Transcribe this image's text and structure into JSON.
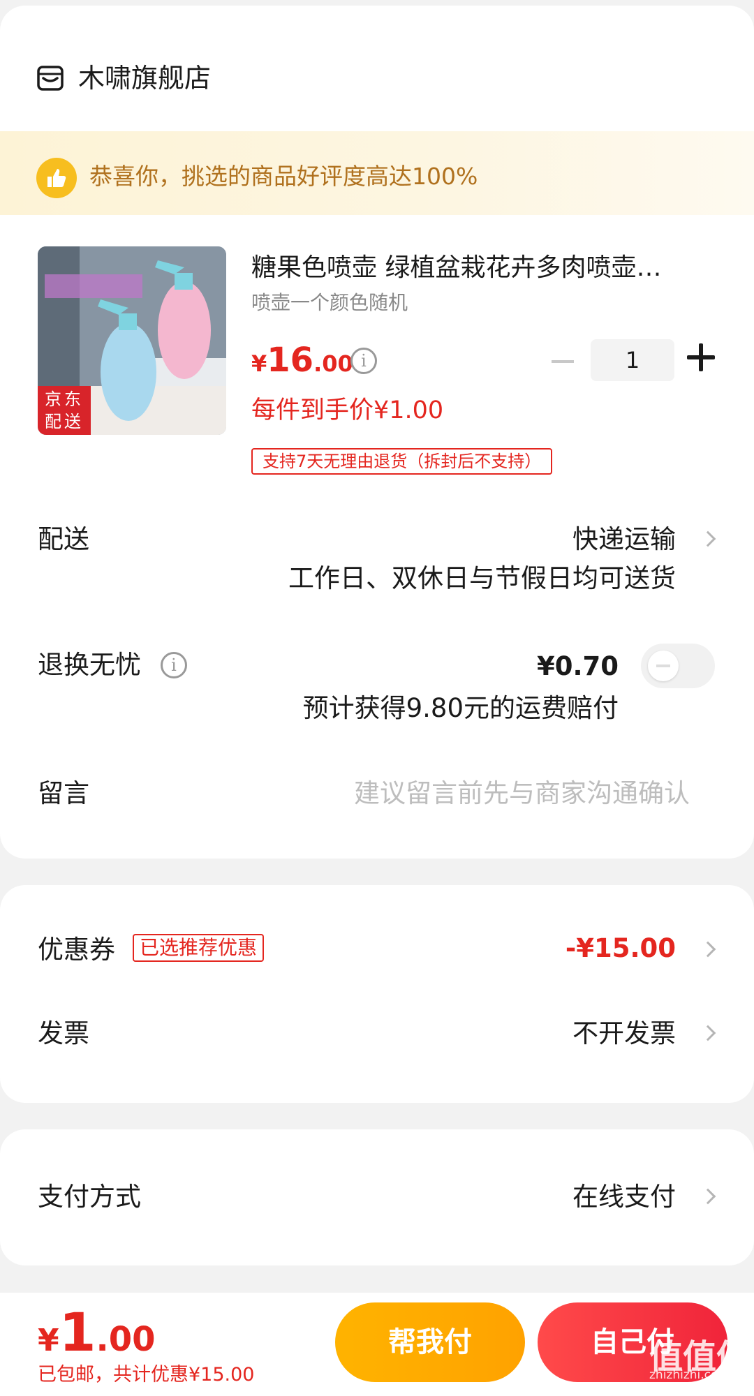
{
  "shop": {
    "name": "木啸旗舰店",
    "icon": "shop-icon"
  },
  "banner": {
    "text": "恭喜你，挑选的商品好评度高达100%",
    "icon": "thumbs-up-icon"
  },
  "product": {
    "title": "糖果色喷壶  绿植盆栽花卉多肉喷壶…",
    "spec": "喷壶一个颜色随机",
    "image_badge_line1": "京东",
    "image_badge_line2": "配送",
    "image_caption": "糖果色喷壶",
    "price_symbol": "¥",
    "price_int": "16",
    "price_dec": ".00",
    "quantity": "1",
    "hand_price": "每件到手价¥1.00",
    "return_tag": "支持7天无理由退货（拆封后不支持）"
  },
  "delivery": {
    "label": "配送",
    "value": "快递运输",
    "sub": "工作日、双休日与节假日均可送货"
  },
  "return_insurance": {
    "label": "退换无忧",
    "price": "¥0.70",
    "sub": "预计获得9.80元的运费赔付",
    "enabled": false
  },
  "message": {
    "label": "留言",
    "placeholder": "建议留言前先与商家沟通确认"
  },
  "coupon": {
    "label": "优惠券",
    "tag": "已选推荐优惠",
    "value": "-¥15.00"
  },
  "invoice": {
    "label": "发票",
    "value": "不开发票"
  },
  "payment": {
    "label": "支付方式",
    "value": "在线支付"
  },
  "footer": {
    "total_symbol": "¥",
    "total_int": "1",
    "total_dec": ".00",
    "note": "已包邮，共计优惠¥15.00",
    "help_pay": "帮我付",
    "self_pay": "自己付",
    "watermark": "值值值",
    "watermark_sub": "zhizhizhi.com"
  },
  "colors": {
    "accent_red": "#e4261f",
    "banner_text": "#b0711e",
    "help_btn": "#ffb300",
    "self_btn": "#f0243a"
  }
}
